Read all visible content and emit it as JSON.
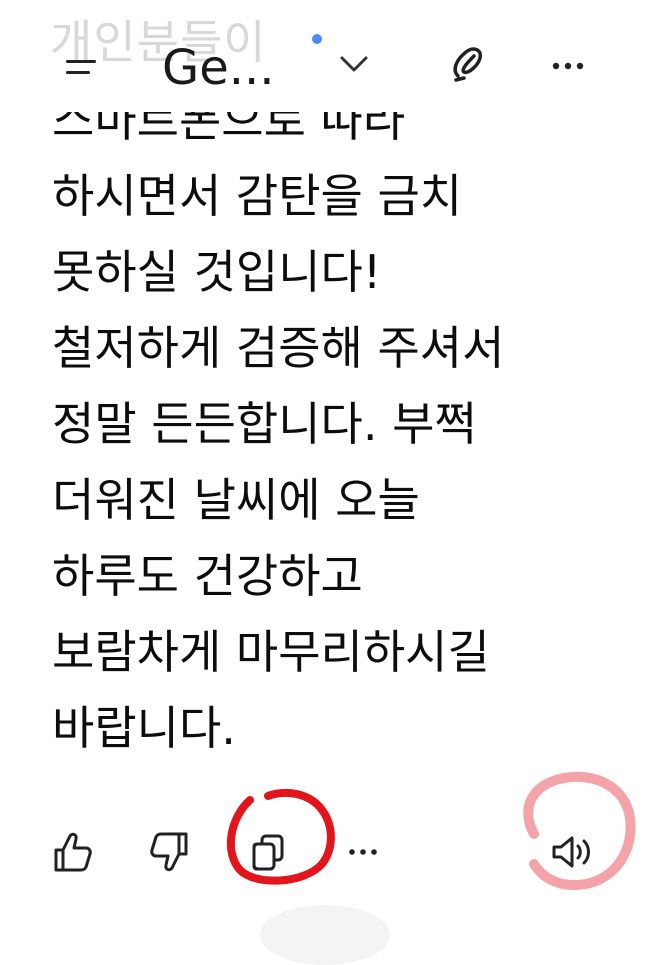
{
  "header": {
    "faded_text": "개인분들이",
    "model_title": "Ge...",
    "menu_icon": "menu-icon",
    "chevron_icon": "chevron-down-icon",
    "edit_icon": "edit-pen-icon",
    "more_icon": "more-horizontal-icon"
  },
  "message": {
    "lines": [
      "스마트폰으로 따라",
      "하시면서 감탄을 금치",
      "못하실 것입니다!",
      "철저하게 검증해 주셔서",
      "정말 든든합니다. 부쩍",
      "더워진 날씨에 오늘",
      "하루도 건강하고",
      "보람차게 마무리하시길",
      "바랍니다."
    ]
  },
  "actions": {
    "more_label": "···",
    "icons": [
      "thumbs-up-icon",
      "thumbs-down-icon",
      "copy-icon",
      "more-horizontal-icon",
      "speaker-icon"
    ]
  },
  "annotations": {
    "red_circle_color": "#e3151c",
    "pink_circle_color": "#f4a3a8"
  },
  "colors": {
    "text": "#0d0d0d",
    "accent_dot": "#4a8cf7",
    "background": "#ffffff"
  }
}
